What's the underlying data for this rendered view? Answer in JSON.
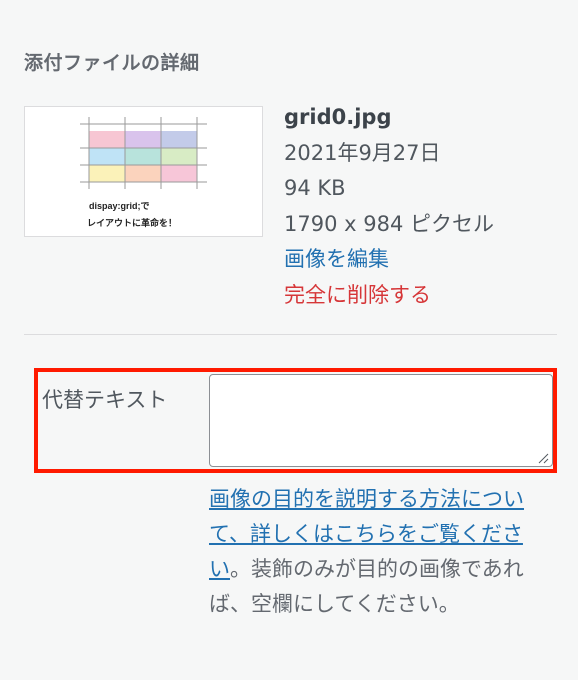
{
  "section": {
    "title": "添付ファイルの詳細"
  },
  "thumbnail": {
    "caption_line1": "dispay:grid;で",
    "caption_line2": "レイアウトに革命を！",
    "cell_colors": [
      [
        "#f7c6d3",
        "#d9c3ec",
        "#c3cbe9"
      ],
      [
        "#bfe3f6",
        "#b8e3dc",
        "#d8ecc5"
      ],
      [
        "#fbf2b9",
        "#fbd3bd",
        "#f7c6d8"
      ]
    ]
  },
  "file": {
    "name": "grid0.jpg",
    "date": "2021年9月27日",
    "size": "94 KB",
    "dimensions": "1790 x 984 ピクセル",
    "edit_link": "画像を編集",
    "delete_link": "完全に削除する"
  },
  "alt": {
    "label": "代替テキスト",
    "value": ""
  },
  "help": {
    "link_text": "画像の目的を説明する方法について、詳しくはこちらをご覧ください",
    "text": "。装飾のみが目的の画像であれば、空欄にしてください。"
  },
  "colors": {
    "link": "#2271b1",
    "danger": "#d63638",
    "highlight": "#ff1a00",
    "background": "#f6f7f7"
  }
}
